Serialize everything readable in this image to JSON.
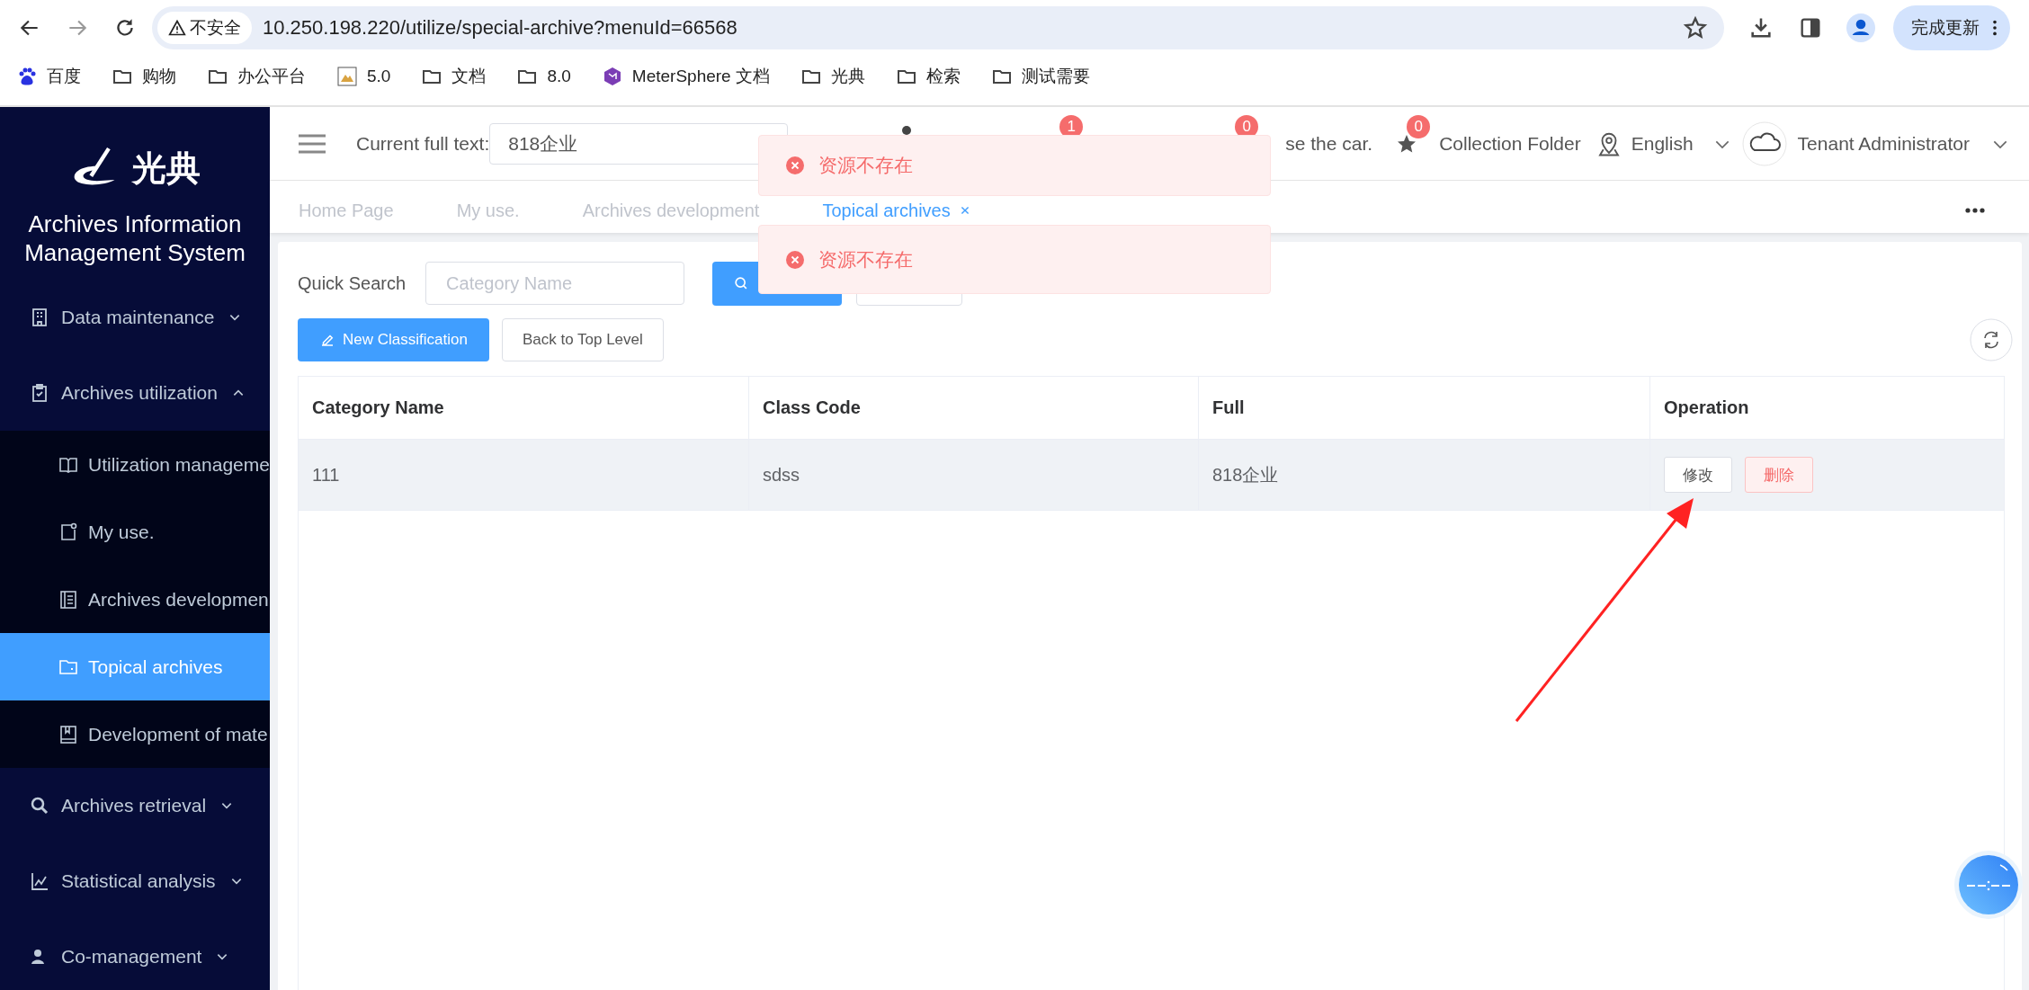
{
  "browser": {
    "security": "不安全",
    "url": "10.250.198.220/utilize/special-archive?menuId=66568",
    "update_button": "完成更新",
    "bookmarks": [
      {
        "label": "百度",
        "kind": "baidu"
      },
      {
        "label": "购物",
        "kind": "folder"
      },
      {
        "label": "办公平台",
        "kind": "folder"
      },
      {
        "label": "5.0",
        "kind": "image"
      },
      {
        "label": "文档",
        "kind": "folder"
      },
      {
        "label": "8.0",
        "kind": "folder"
      },
      {
        "label": "MeterSphere 文档",
        "kind": "app"
      },
      {
        "label": "光典",
        "kind": "folder"
      },
      {
        "label": "检索",
        "kind": "folder"
      },
      {
        "label": "测试需要",
        "kind": "folder"
      }
    ]
  },
  "sidebar": {
    "logo": "光典",
    "title_lines": [
      "Archives Information",
      "Management System"
    ],
    "menu": [
      {
        "label": "Data maintenance",
        "expanded": false
      },
      {
        "label": "Archives utilization",
        "expanded": true,
        "children": [
          {
            "label": "Utilization manageme",
            "selected": false
          },
          {
            "label": "My use.",
            "selected": false
          },
          {
            "label": "Archives developmen",
            "selected": false
          },
          {
            "label": "Topical archives",
            "selected": true
          },
          {
            "label": "Development of mate",
            "selected": false
          }
        ]
      },
      {
        "label": "Archives retrieval",
        "expanded": false
      },
      {
        "label": "Statistical analysis",
        "expanded": false
      },
      {
        "label": "Co-management",
        "expanded": false
      }
    ]
  },
  "header": {
    "current_label": "Current full text:",
    "current_value": "818企业",
    "notifications": [
      {
        "badge": "1"
      },
      {
        "badge": "0",
        "label": "se the car."
      }
    ],
    "collection": {
      "badge": "0",
      "label": "Collection Folder"
    },
    "language": "English",
    "user": "Tenant Administrator"
  },
  "tabs": [
    {
      "label": "Home Page",
      "selected": false,
      "closable": false
    },
    {
      "label": "My use.",
      "selected": false,
      "closable": false
    },
    {
      "label": "Archives development",
      "selected": false,
      "closable": false
    },
    {
      "label": "Topical archives",
      "selected": true,
      "closable": true
    }
  ],
  "toasts": [
    {
      "message": "资源不存在",
      "kind": "error"
    },
    {
      "message": "资源不存在",
      "kind": "error"
    }
  ],
  "content": {
    "quick_search_label": "Quick Search",
    "search_placeholder": "Category Name",
    "new_button": "New Classification",
    "back_button": "Back to Top Level",
    "table": {
      "columns": [
        "Category Name",
        "Class Code",
        "Full",
        "Operation"
      ],
      "rows": [
        {
          "cells": [
            "111",
            "sdss",
            "818企业"
          ],
          "highlighted": true,
          "actions": [
            {
              "label": "修改",
              "kind": "edit"
            },
            {
              "label": "删除",
              "kind": "delete"
            }
          ]
        }
      ]
    }
  }
}
